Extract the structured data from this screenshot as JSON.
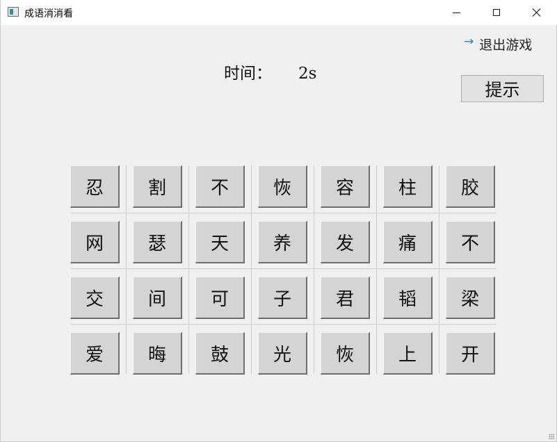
{
  "window": {
    "title": "成语消消看",
    "app_icon": "window-app-icon"
  },
  "controls": {
    "exit_icon": "arrow-right-icon",
    "exit_arrow": "→",
    "exit_label": "退出游戏",
    "hint_label": "提示"
  },
  "timer": {
    "label": "时间：",
    "value": "2s"
  },
  "colors": {
    "exit_arrow": "#1e86d6",
    "background": "#f0f0f0",
    "tile": "#d4d4d4"
  },
  "board": {
    "rows": [
      [
        "忍",
        "割",
        "不",
        "恢",
        "容",
        "柱",
        "胶"
      ],
      [
        "网",
        "瑟",
        "天",
        "养",
        "发",
        "痛",
        "不"
      ],
      [
        "交",
        "间",
        "可",
        "子",
        "君",
        "韬",
        "梁"
      ],
      [
        "爱",
        "晦",
        "鼓",
        "光",
        "恢",
        "上",
        "开"
      ]
    ]
  }
}
